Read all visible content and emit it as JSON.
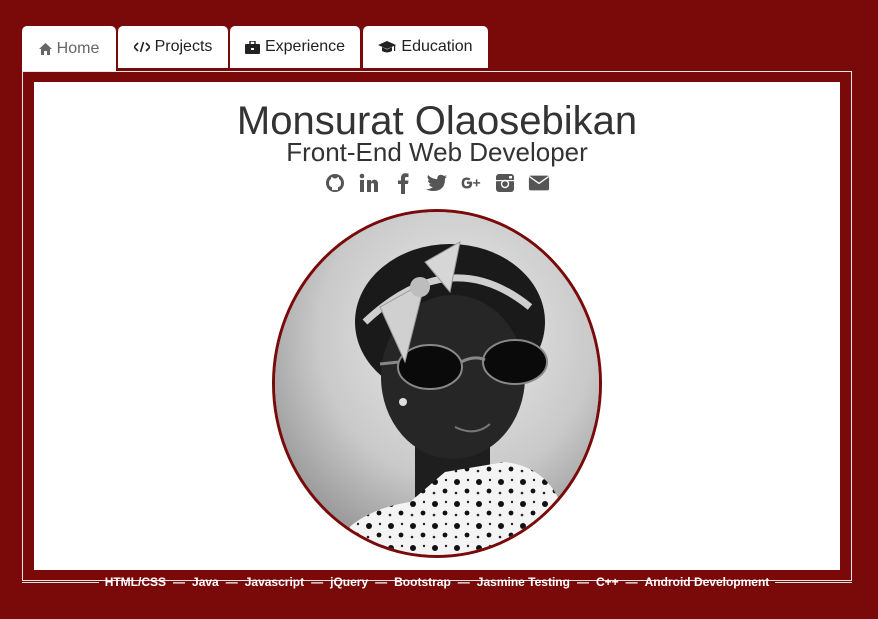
{
  "tabs": [
    {
      "label": "Home",
      "icon": "home-icon",
      "active": true
    },
    {
      "label": "Projects",
      "icon": "code-icon"
    },
    {
      "label": "Experience",
      "icon": "briefcase-icon"
    },
    {
      "label": "Education",
      "icon": "graduation-cap-icon"
    }
  ],
  "profile": {
    "name": "Monsurat Olaosebikan",
    "role": "Front-End Web Developer"
  },
  "social_icons": [
    "github-icon",
    "linkedin-icon",
    "facebook-icon",
    "twitter-icon",
    "google-plus-icon",
    "instagram-icon",
    "email-icon"
  ],
  "skills": [
    "HTML/CSS",
    "Java",
    "Javascript",
    "jQuery",
    "Bootstrap",
    "Jasmine Testing",
    "C++",
    "Android Development"
  ],
  "colors": {
    "brand": "#7a0a0a",
    "panel": "#ffffff",
    "text": "#333333"
  }
}
